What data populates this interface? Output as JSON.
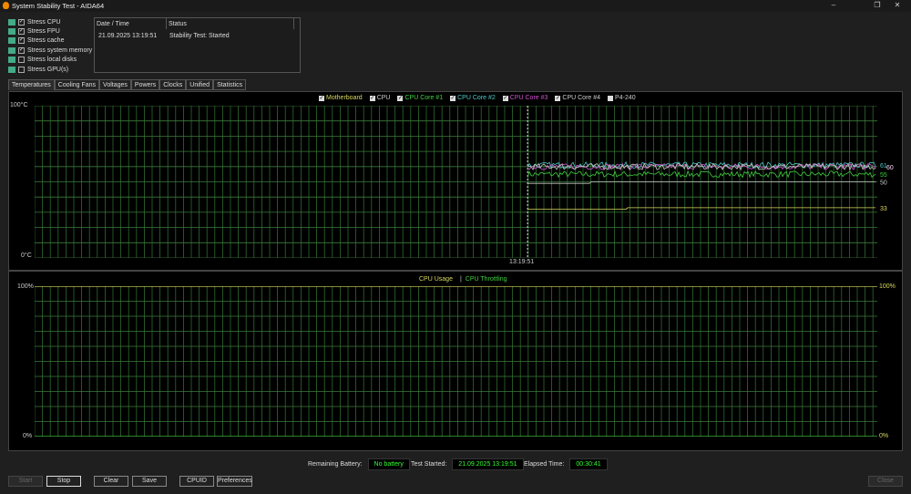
{
  "window": {
    "title": "System Stability Test - AIDA64"
  },
  "stress_options": [
    {
      "label": "Stress CPU",
      "checked": true,
      "icon": "cpu-icon"
    },
    {
      "label": "Stress FPU",
      "checked": true,
      "icon": "fpu-icon"
    },
    {
      "label": "Stress cache",
      "checked": true,
      "icon": "cache-icon"
    },
    {
      "label": "Stress system memory",
      "checked": true,
      "icon": "memory-icon"
    },
    {
      "label": "Stress local disks",
      "checked": false,
      "icon": "disk-icon"
    },
    {
      "label": "Stress GPU(s)",
      "checked": false,
      "icon": "gpu-icon"
    }
  ],
  "log": {
    "headers": [
      "Date / Time",
      "Status"
    ],
    "rows": [
      [
        "21.09.2025 13:19:51",
        "Stability Test: Started"
      ]
    ]
  },
  "tabs": [
    "Temperatures",
    "Cooling Fans",
    "Voltages",
    "Powers",
    "Clocks",
    "Unified",
    "Statistics"
  ],
  "active_tab": "Temperatures",
  "chart_data": [
    {
      "type": "line",
      "ylim": [
        0,
        100
      ],
      "y_top_label": "100°C",
      "y_bottom_label": "0°C",
      "x_label": "13:19:51",
      "grid": true,
      "series": [
        {
          "name": "Motherboard",
          "color": "#d8d860",
          "checked": true,
          "current": 33
        },
        {
          "name": "CPU",
          "color": "#c8c8c8",
          "checked": true,
          "current": 50
        },
        {
          "name": "CPU Core #1",
          "color": "#40d040",
          "checked": true,
          "current": 55
        },
        {
          "name": "CPU Core #2",
          "color": "#50c8c8",
          "checked": true,
          "current": 61
        },
        {
          "name": "CPU Core #3",
          "color": "#d050d0",
          "checked": true,
          "current": 60
        },
        {
          "name": "CPU Core #4",
          "color": "#c8c8c8",
          "checked": true,
          "current": 60
        },
        {
          "name": "P4-240",
          "color": "#c8c8c8",
          "checked": false,
          "current": null
        }
      ]
    },
    {
      "type": "line",
      "ylim": [
        0,
        100
      ],
      "y_top_label": "100%",
      "y_bottom_label": "0%",
      "right_top_label": "100%",
      "right_bottom_label": "0%",
      "grid": true,
      "series": [
        {
          "name": "CPU Usage",
          "color": "#d8d860",
          "current": 100
        },
        {
          "name": "CPU Throttling",
          "color": "#40d040",
          "current": 0
        }
      ],
      "separator": "|"
    }
  ],
  "status": {
    "battery_label": "Remaining Battery:",
    "battery_value": "No battery",
    "started_label": "Test Started:",
    "started_value": "21.09.2025 13:19:51",
    "elapsed_label": "Elapsed Time:",
    "elapsed_value": "00:30:41"
  },
  "buttons": {
    "start": "Start",
    "stop": "Stop",
    "clear": "Clear",
    "save": "Save",
    "cpuid": "CPUID",
    "preferences": "Preferences",
    "close": "Close"
  }
}
